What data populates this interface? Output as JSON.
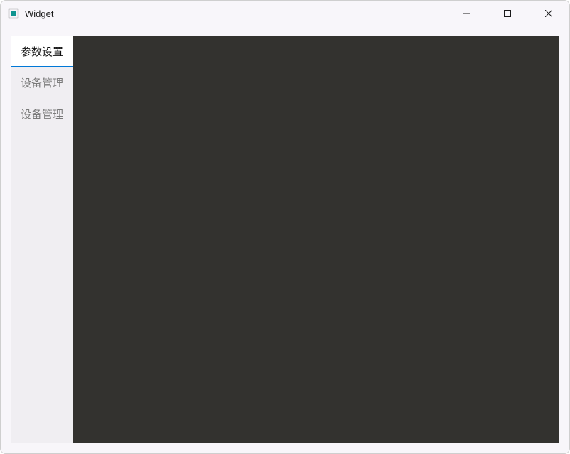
{
  "window": {
    "title": "Widget"
  },
  "tabs": [
    {
      "label": "参数设置",
      "active": true
    },
    {
      "label": "设备管理",
      "active": false
    },
    {
      "label": "设备管理",
      "active": false
    }
  ]
}
